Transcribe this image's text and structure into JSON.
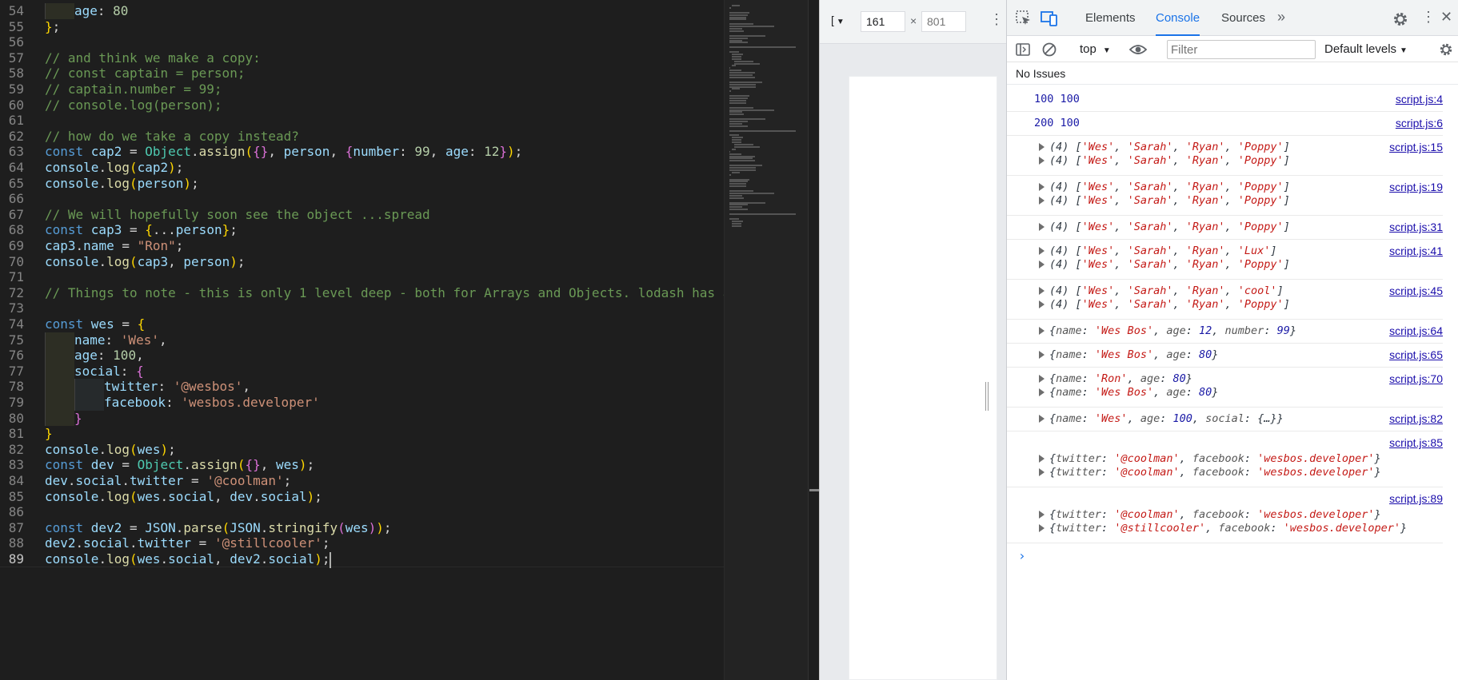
{
  "editor": {
    "lines": [
      {
        "n": "54",
        "indent": 1,
        "tokens": [
          [
            "v",
            "age"
          ],
          [
            "p",
            ": "
          ],
          [
            "n",
            "80"
          ]
        ]
      },
      {
        "n": "55",
        "indent": 0,
        "tokens": [
          [
            "b1",
            "}"
          ],
          [
            "p",
            ";"
          ]
        ]
      },
      {
        "n": "56",
        "indent": 0,
        "tokens": []
      },
      {
        "n": "57",
        "indent": 0,
        "tokens": [
          [
            "c",
            "// and think we make a copy:"
          ]
        ]
      },
      {
        "n": "58",
        "indent": 0,
        "tokens": [
          [
            "c",
            "// const captain = person;"
          ]
        ]
      },
      {
        "n": "59",
        "indent": 0,
        "tokens": [
          [
            "c",
            "// captain.number = 99;"
          ]
        ]
      },
      {
        "n": "60",
        "indent": 0,
        "tokens": [
          [
            "c",
            "// console.log(person);"
          ]
        ]
      },
      {
        "n": "61",
        "indent": 0,
        "tokens": []
      },
      {
        "n": "62",
        "indent": 0,
        "tokens": [
          [
            "c",
            "// how do we take a copy instead?"
          ]
        ]
      },
      {
        "n": "63",
        "indent": 0,
        "tokens": [
          [
            "k",
            "const "
          ],
          [
            "v",
            "cap2"
          ],
          [
            "p",
            " = "
          ],
          [
            "t",
            "Object"
          ],
          [
            "p",
            "."
          ],
          [
            "f",
            "assign"
          ],
          [
            "b1",
            "("
          ],
          [
            "b2",
            "{}"
          ],
          [
            "p",
            ", "
          ],
          [
            "v",
            "person"
          ],
          [
            "p",
            ", "
          ],
          [
            "b2",
            "{"
          ],
          [
            "v",
            "number"
          ],
          [
            "p",
            ": "
          ],
          [
            "n",
            "99"
          ],
          [
            "p",
            ", "
          ],
          [
            "v",
            "age"
          ],
          [
            "p",
            ": "
          ],
          [
            "n",
            "12"
          ],
          [
            "b2",
            "}"
          ],
          [
            "b1",
            ")"
          ],
          [
            "p",
            ";"
          ]
        ]
      },
      {
        "n": "64",
        "indent": 0,
        "tokens": [
          [
            "v",
            "console"
          ],
          [
            "p",
            "."
          ],
          [
            "f",
            "log"
          ],
          [
            "b1",
            "("
          ],
          [
            "v",
            "cap2"
          ],
          [
            "b1",
            ")"
          ],
          [
            "p",
            ";"
          ]
        ]
      },
      {
        "n": "65",
        "indent": 0,
        "tokens": [
          [
            "v",
            "console"
          ],
          [
            "p",
            "."
          ],
          [
            "f",
            "log"
          ],
          [
            "b1",
            "("
          ],
          [
            "v",
            "person"
          ],
          [
            "b1",
            ")"
          ],
          [
            "p",
            ";"
          ]
        ]
      },
      {
        "n": "66",
        "indent": 0,
        "tokens": []
      },
      {
        "n": "67",
        "indent": 0,
        "tokens": [
          [
            "c",
            "// We will hopefully soon see the object ...spread"
          ]
        ]
      },
      {
        "n": "68",
        "indent": 0,
        "tokens": [
          [
            "k",
            "const "
          ],
          [
            "v",
            "cap3"
          ],
          [
            "p",
            " = "
          ],
          [
            "b1",
            "{"
          ],
          [
            "p",
            "..."
          ],
          [
            "v",
            "person"
          ],
          [
            "b1",
            "}"
          ],
          [
            "p",
            ";"
          ]
        ]
      },
      {
        "n": "69",
        "indent": 0,
        "tokens": [
          [
            "v",
            "cap3"
          ],
          [
            "p",
            "."
          ],
          [
            "v",
            "name"
          ],
          [
            "p",
            " = "
          ],
          [
            "s",
            "\"Ron\""
          ],
          [
            "p",
            ";"
          ]
        ]
      },
      {
        "n": "70",
        "indent": 0,
        "tokens": [
          [
            "v",
            "console"
          ],
          [
            "p",
            "."
          ],
          [
            "f",
            "log"
          ],
          [
            "b1",
            "("
          ],
          [
            "v",
            "cap3"
          ],
          [
            "p",
            ", "
          ],
          [
            "v",
            "person"
          ],
          [
            "b1",
            ")"
          ],
          [
            "p",
            ";"
          ]
        ]
      },
      {
        "n": "71",
        "indent": 0,
        "tokens": []
      },
      {
        "n": "72",
        "indent": 0,
        "tokens": [
          [
            "c",
            "// Things to note - this is only 1 level deep - both for Arrays and Objects. lodash has a cl"
          ]
        ]
      },
      {
        "n": "73",
        "indent": 0,
        "tokens": []
      },
      {
        "n": "74",
        "indent": 0,
        "tokens": [
          [
            "k",
            "const "
          ],
          [
            "v",
            "wes"
          ],
          [
            "p",
            " = "
          ],
          [
            "b1",
            "{"
          ]
        ]
      },
      {
        "n": "75",
        "indent": 1,
        "tokens": [
          [
            "v",
            "name"
          ],
          [
            "p",
            ": "
          ],
          [
            "s",
            "'Wes'"
          ],
          [
            "p",
            ","
          ]
        ]
      },
      {
        "n": "76",
        "indent": 1,
        "tokens": [
          [
            "v",
            "age"
          ],
          [
            "p",
            ": "
          ],
          [
            "n",
            "100"
          ],
          [
            "p",
            ","
          ]
        ]
      },
      {
        "n": "77",
        "indent": 1,
        "tokens": [
          [
            "v",
            "social"
          ],
          [
            "p",
            ": "
          ],
          [
            "b2",
            "{"
          ]
        ]
      },
      {
        "n": "78",
        "indent": 2,
        "tokens": [
          [
            "v",
            "twitter"
          ],
          [
            "p",
            ": "
          ],
          [
            "s",
            "'@wesbos'"
          ],
          [
            "p",
            ","
          ]
        ]
      },
      {
        "n": "79",
        "indent": 2,
        "tokens": [
          [
            "v",
            "facebook"
          ],
          [
            "p",
            ": "
          ],
          [
            "s",
            "'wesbos.developer'"
          ]
        ]
      },
      {
        "n": "80",
        "indent": 1,
        "tokens": [
          [
            "b2",
            "}"
          ]
        ]
      },
      {
        "n": "81",
        "indent": 0,
        "tokens": [
          [
            "b1",
            "}"
          ]
        ]
      },
      {
        "n": "82",
        "indent": 0,
        "tokens": [
          [
            "v",
            "console"
          ],
          [
            "p",
            "."
          ],
          [
            "f",
            "log"
          ],
          [
            "b1",
            "("
          ],
          [
            "v",
            "wes"
          ],
          [
            "b1",
            ")"
          ],
          [
            "p",
            ";"
          ]
        ]
      },
      {
        "n": "83",
        "indent": 0,
        "tokens": [
          [
            "k",
            "const "
          ],
          [
            "v",
            "dev"
          ],
          [
            "p",
            " = "
          ],
          [
            "t",
            "Object"
          ],
          [
            "p",
            "."
          ],
          [
            "f",
            "assign"
          ],
          [
            "b1",
            "("
          ],
          [
            "b2",
            "{}"
          ],
          [
            "p",
            ", "
          ],
          [
            "v",
            "wes"
          ],
          [
            "b1",
            ")"
          ],
          [
            "p",
            ";"
          ]
        ]
      },
      {
        "n": "84",
        "indent": 0,
        "tokens": [
          [
            "v",
            "dev"
          ],
          [
            "p",
            "."
          ],
          [
            "v",
            "social"
          ],
          [
            "p",
            "."
          ],
          [
            "v",
            "twitter"
          ],
          [
            "p",
            " = "
          ],
          [
            "s",
            "'@coolman'"
          ],
          [
            "p",
            ";"
          ]
        ]
      },
      {
        "n": "85",
        "indent": 0,
        "tokens": [
          [
            "v",
            "console"
          ],
          [
            "p",
            "."
          ],
          [
            "f",
            "log"
          ],
          [
            "b1",
            "("
          ],
          [
            "v",
            "wes"
          ],
          [
            "p",
            "."
          ],
          [
            "v",
            "social"
          ],
          [
            "p",
            ", "
          ],
          [
            "v",
            "dev"
          ],
          [
            "p",
            "."
          ],
          [
            "v",
            "social"
          ],
          [
            "b1",
            ")"
          ],
          [
            "p",
            ";"
          ]
        ]
      },
      {
        "n": "86",
        "indent": 0,
        "tokens": []
      },
      {
        "n": "87",
        "indent": 0,
        "tokens": [
          [
            "k",
            "const "
          ],
          [
            "v",
            "dev2"
          ],
          [
            "p",
            " = "
          ],
          [
            "v",
            "JSON"
          ],
          [
            "p",
            "."
          ],
          [
            "f",
            "parse"
          ],
          [
            "b1",
            "("
          ],
          [
            "v",
            "JSON"
          ],
          [
            "p",
            "."
          ],
          [
            "f",
            "stringify"
          ],
          [
            "b2",
            "("
          ],
          [
            "v",
            "wes"
          ],
          [
            "b2",
            ")"
          ],
          [
            "b1",
            ")"
          ],
          [
            "p",
            ";"
          ]
        ]
      },
      {
        "n": "88",
        "indent": 0,
        "tokens": [
          [
            "v",
            "dev2"
          ],
          [
            "p",
            "."
          ],
          [
            "v",
            "social"
          ],
          [
            "p",
            "."
          ],
          [
            "v",
            "twitter"
          ],
          [
            "p",
            " = "
          ],
          [
            "s",
            "'@stillcooler'"
          ],
          [
            "p",
            ";"
          ]
        ]
      },
      {
        "n": "89",
        "indent": 0,
        "tokens": [
          [
            "v",
            "console"
          ],
          [
            "p",
            "."
          ],
          [
            "f",
            "log"
          ],
          [
            "b1",
            "("
          ],
          [
            "v",
            "wes"
          ],
          [
            "p",
            "."
          ],
          [
            "v",
            "social"
          ],
          [
            "p",
            ", "
          ],
          [
            "v",
            "dev2"
          ],
          [
            "p",
            "."
          ],
          [
            "v",
            "social"
          ],
          [
            "b1",
            ")"
          ],
          [
            "p",
            ";"
          ]
        ]
      }
    ]
  },
  "viewport": {
    "device_icon": "[",
    "width": "161",
    "times": "×",
    "height_placeholder": "801",
    "more": "⋮"
  },
  "devtools": {
    "tabs": [
      {
        "label": "Elements",
        "active": false
      },
      {
        "label": "Console",
        "active": true
      },
      {
        "label": "Sources",
        "active": false
      }
    ],
    "more_tabs": "»",
    "kebab": "⋮",
    "close": "✕",
    "context": "top",
    "filter_placeholder": "Filter",
    "levels": "Default levels",
    "issues": "No Issues",
    "prompt": "›",
    "colors": {
      "accent": "#1a73e8",
      "string": "#c41a16",
      "number": "#1a1aa6",
      "link": "#1a0dab"
    }
  },
  "console": [
    {
      "source": "script.js:4",
      "lines": [
        {
          "kind": "plain",
          "text": "100 100"
        }
      ]
    },
    {
      "source": "script.js:6",
      "lines": [
        {
          "kind": "plain",
          "text": "200 100"
        }
      ]
    },
    {
      "source": "script.js:15",
      "lines": [
        {
          "kind": "array",
          "count": "(4)",
          "items": [
            "'Wes'",
            "'Sarah'",
            "'Ryan'",
            "'Poppy'"
          ]
        },
        {
          "kind": "array",
          "count": "(4)",
          "items": [
            "'Wes'",
            "'Sarah'",
            "'Ryan'",
            "'Poppy'"
          ]
        }
      ]
    },
    {
      "source": "script.js:19",
      "lines": [
        {
          "kind": "array",
          "count": "(4)",
          "items": [
            "'Wes'",
            "'Sarah'",
            "'Ryan'",
            "'Poppy'"
          ]
        },
        {
          "kind": "array",
          "count": "(4)",
          "items": [
            "'Wes'",
            "'Sarah'",
            "'Ryan'",
            "'Poppy'"
          ]
        }
      ]
    },
    {
      "source": "script.js:31",
      "lines": [
        {
          "kind": "array",
          "count": "(4)",
          "items": [
            "'Wes'",
            "'Sarah'",
            "'Ryan'",
            "'Poppy'"
          ]
        }
      ]
    },
    {
      "source": "script.js:41",
      "lines": [
        {
          "kind": "array",
          "count": "(4)",
          "items": [
            "'Wes'",
            "'Sarah'",
            "'Ryan'",
            "'Lux'"
          ]
        },
        {
          "kind": "array",
          "count": "(4)",
          "items": [
            "'Wes'",
            "'Sarah'",
            "'Ryan'",
            "'Poppy'"
          ]
        }
      ]
    },
    {
      "source": "script.js:45",
      "lines": [
        {
          "kind": "array",
          "count": "(4)",
          "items": [
            "'Wes'",
            "'Sarah'",
            "'Ryan'",
            "'cool'"
          ]
        },
        {
          "kind": "array",
          "count": "(4)",
          "items": [
            "'Wes'",
            "'Sarah'",
            "'Ryan'",
            "'Poppy'"
          ]
        }
      ]
    },
    {
      "source": "script.js:64",
      "lines": [
        {
          "kind": "object",
          "props": [
            [
              "name",
              "'Wes Bos'",
              "s"
            ],
            [
              "age",
              "12",
              "n"
            ],
            [
              "number",
              "99",
              "n"
            ]
          ]
        }
      ]
    },
    {
      "source": "script.js:65",
      "lines": [
        {
          "kind": "object",
          "props": [
            [
              "name",
              "'Wes Bos'",
              "s"
            ],
            [
              "age",
              "80",
              "n"
            ]
          ]
        }
      ]
    },
    {
      "source": "script.js:70",
      "lines": [
        {
          "kind": "object",
          "props": [
            [
              "name",
              "'Ron'",
              "s"
            ],
            [
              "age",
              "80",
              "n"
            ]
          ]
        },
        {
          "kind": "object",
          "props": [
            [
              "name",
              "'Wes Bos'",
              "s"
            ],
            [
              "age",
              "80",
              "n"
            ]
          ]
        }
      ]
    },
    {
      "source": "script.js:82",
      "lines": [
        {
          "kind": "object",
          "props": [
            [
              "name",
              "'Wes'",
              "s"
            ],
            [
              "age",
              "100",
              "n"
            ],
            [
              "social",
              "{…}",
              "g"
            ]
          ]
        }
      ]
    },
    {
      "source": "script.js:85",
      "source_own_line": true,
      "lines": [
        {
          "kind": "object",
          "props": [
            [
              "twitter",
              "'@coolman'",
              "s"
            ],
            [
              "facebook",
              "'wesbos.developer'",
              "s"
            ]
          ]
        },
        {
          "kind": "object",
          "props": [
            [
              "twitter",
              "'@coolman'",
              "s"
            ],
            [
              "facebook",
              "'wesbos.developer'",
              "s"
            ]
          ]
        }
      ]
    },
    {
      "source": "script.js:89",
      "source_own_line": true,
      "lines": [
        {
          "kind": "object",
          "props": [
            [
              "twitter",
              "'@coolman'",
              "s"
            ],
            [
              "facebook",
              "'wesbos.developer'",
              "s"
            ]
          ]
        },
        {
          "kind": "object",
          "props": [
            [
              "twitter",
              "'@stillcooler'",
              "s"
            ],
            [
              "facebook",
              "'wesbos.developer'",
              "s"
            ]
          ]
        }
      ]
    }
  ]
}
